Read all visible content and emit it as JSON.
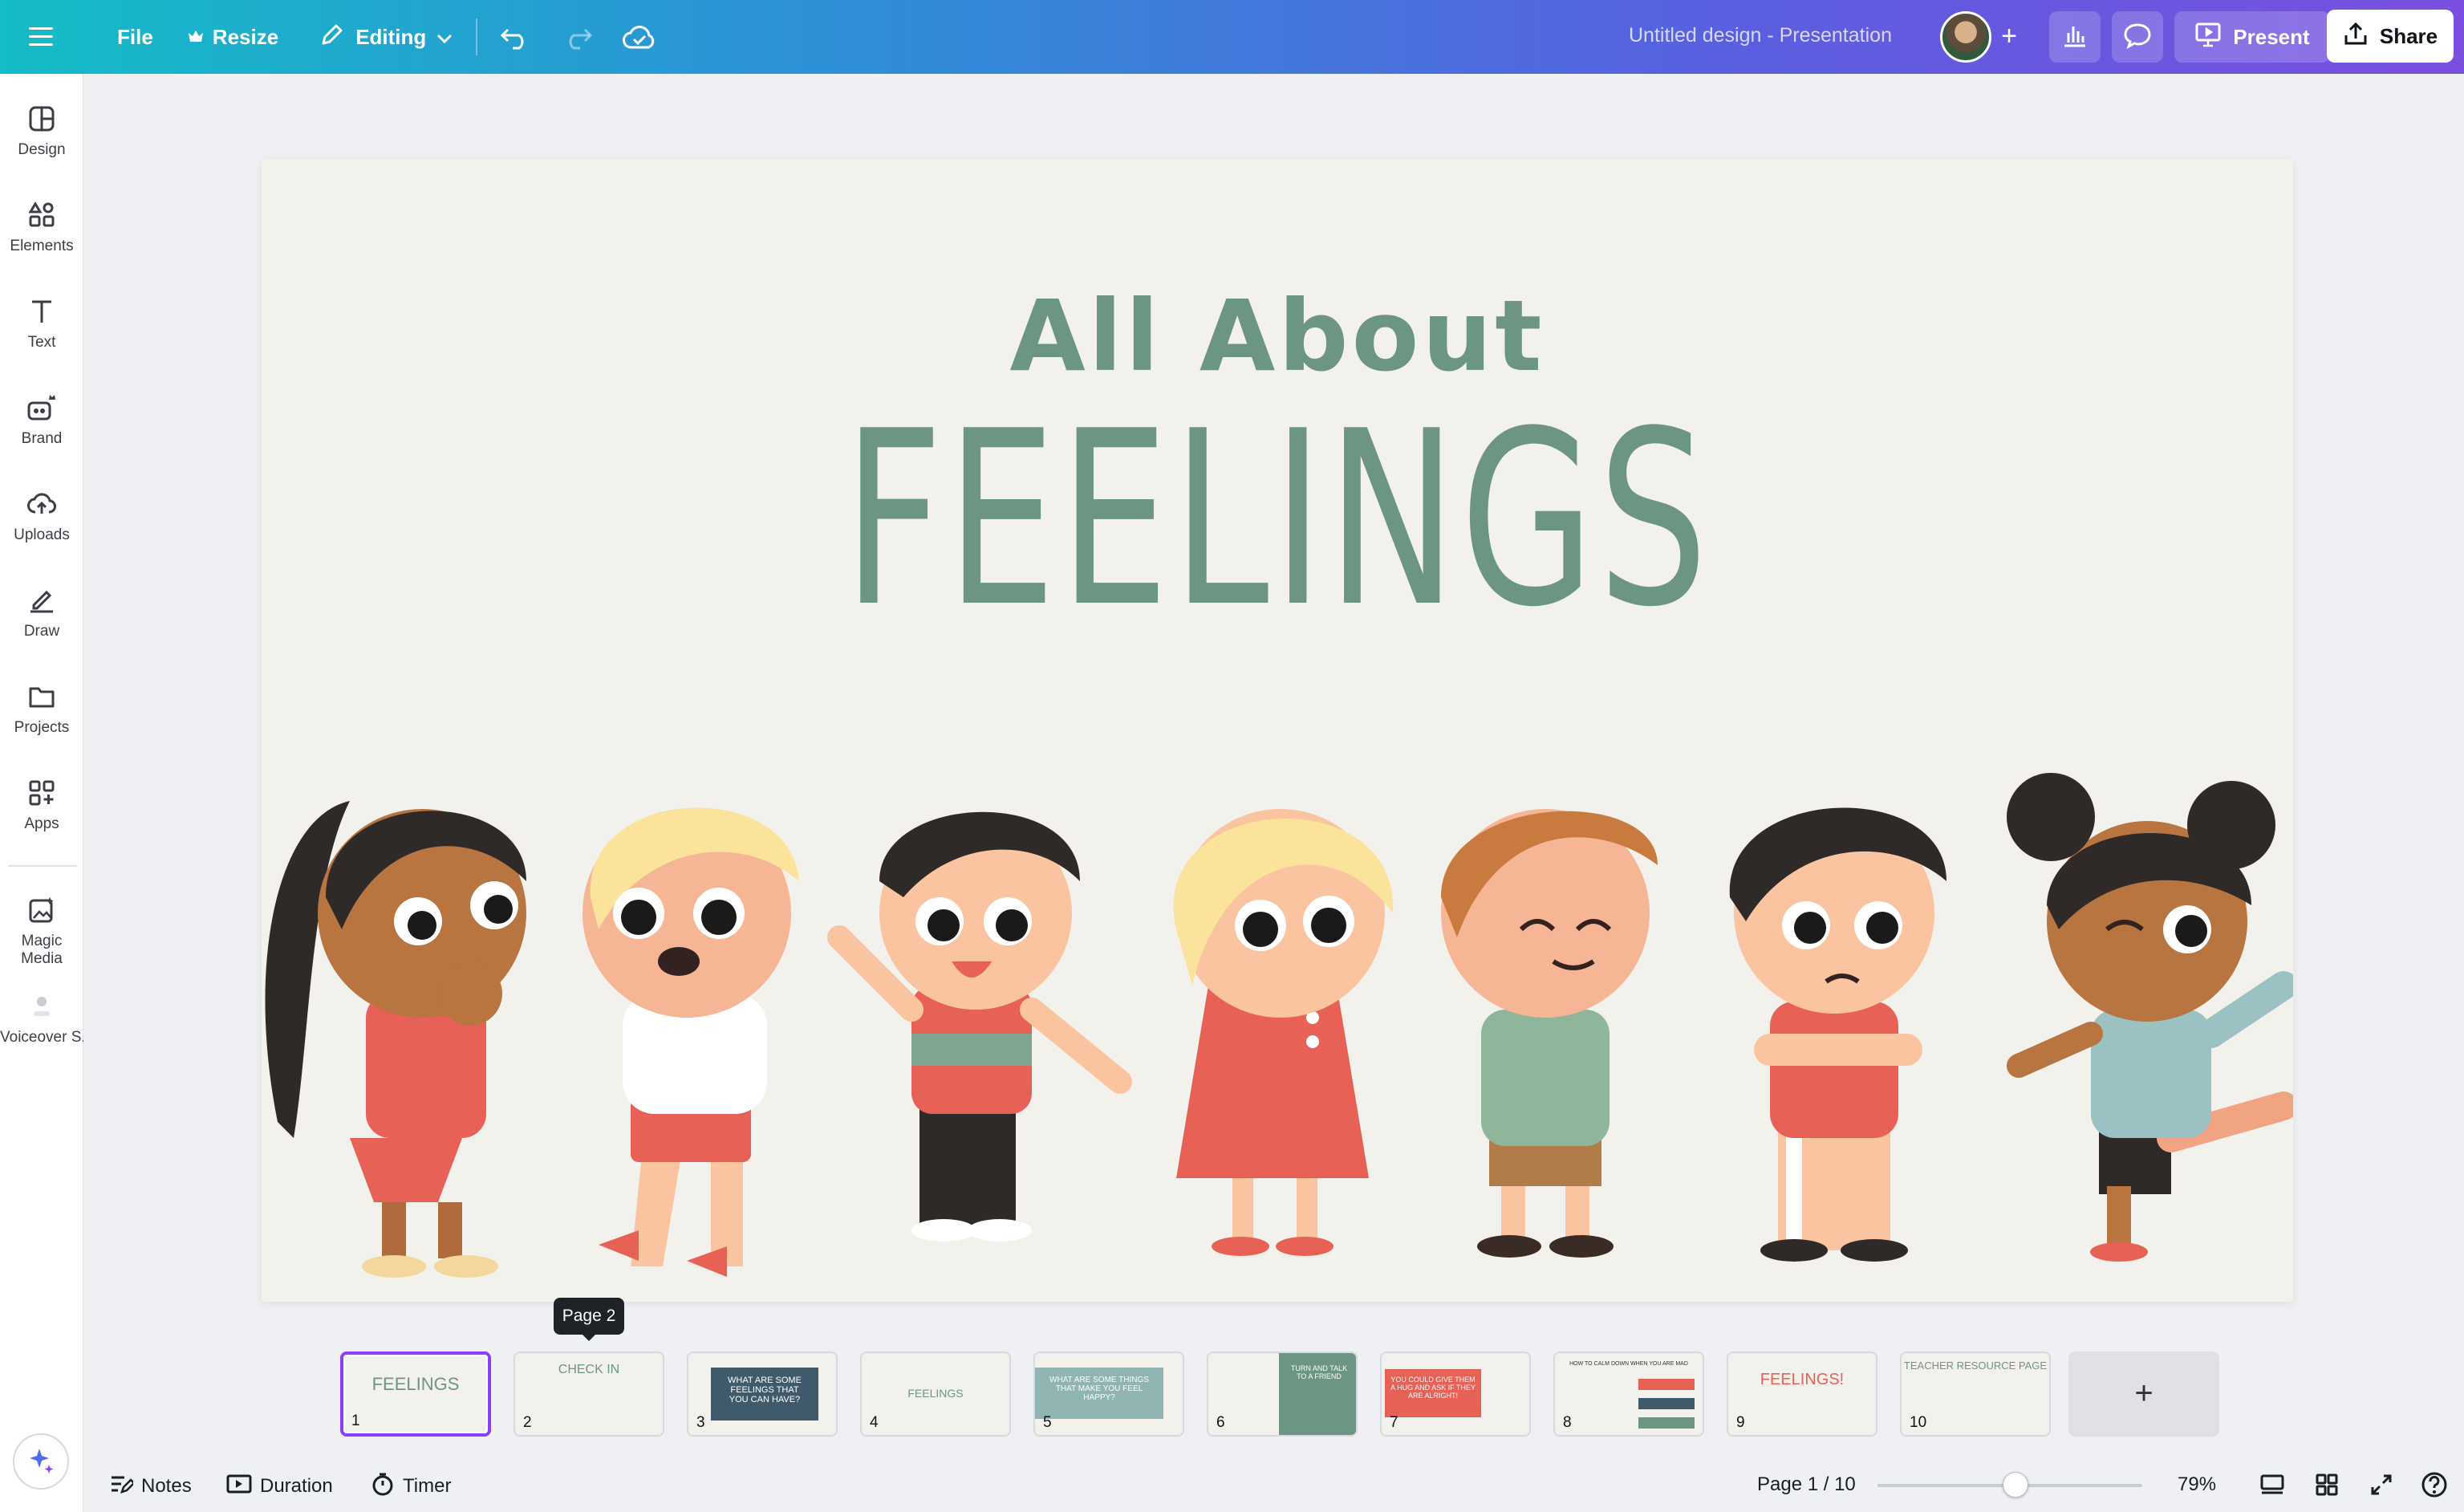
{
  "topbar": {
    "file_label": "File",
    "resize_label": "Resize",
    "editing_label": "Editing",
    "title": "Untitled design - Presentation",
    "present_label": "Present",
    "share_label": "Share"
  },
  "sidebar": {
    "items": [
      {
        "label": "Design",
        "icon": "design-icon"
      },
      {
        "label": "Elements",
        "icon": "elements-icon"
      },
      {
        "label": "Text",
        "icon": "text-icon"
      },
      {
        "label": "Brand",
        "icon": "brand-icon"
      },
      {
        "label": "Uploads",
        "icon": "uploads-icon"
      },
      {
        "label": "Draw",
        "icon": "draw-icon"
      },
      {
        "label": "Projects",
        "icon": "projects-icon"
      },
      {
        "label": "Apps",
        "icon": "apps-icon"
      },
      {
        "label": "Magic Media",
        "icon": "magic-media-icon"
      },
      {
        "label": "Voiceover S...",
        "icon": "voiceover-icon"
      }
    ]
  },
  "slide": {
    "subtitle": "All About",
    "headline": "FEELINGS",
    "text_color": "#6d9583",
    "background": "#f3f1ec"
  },
  "tooltip": "Page 2",
  "pages": [
    {
      "num": "1",
      "title": "FEELINGS"
    },
    {
      "num": "2",
      "title": "CHECK IN"
    },
    {
      "num": "3",
      "title": "WHAT ARE SOME FEELINGS THAT YOU CAN HAVE?"
    },
    {
      "num": "4",
      "title": "FEELINGS"
    },
    {
      "num": "5",
      "title": "WHAT ARE SOME THINGS THAT MAKE YOU FEEL HAPPY?"
    },
    {
      "num": "6",
      "title": "TURN AND TALK TO A FRIEND"
    },
    {
      "num": "7",
      "title": "YOU COULD GIVE THEM A HUG AND ASK IF THEY ARE ALRIGHT!"
    },
    {
      "num": "8",
      "title": "HOW TO CALM DOWN WHEN YOU ARE MAD"
    },
    {
      "num": "9",
      "title": "FEELINGS!"
    },
    {
      "num": "10",
      "title": "TEACHER RESOURCE PAGE"
    }
  ],
  "add_page_label": "+",
  "bottombar": {
    "notes_label": "Notes",
    "duration_label": "Duration",
    "timer_label": "Timer",
    "page_indicator": "Page 1 / 10",
    "zoom_level": "79%",
    "zoom_fraction": 0.52
  }
}
